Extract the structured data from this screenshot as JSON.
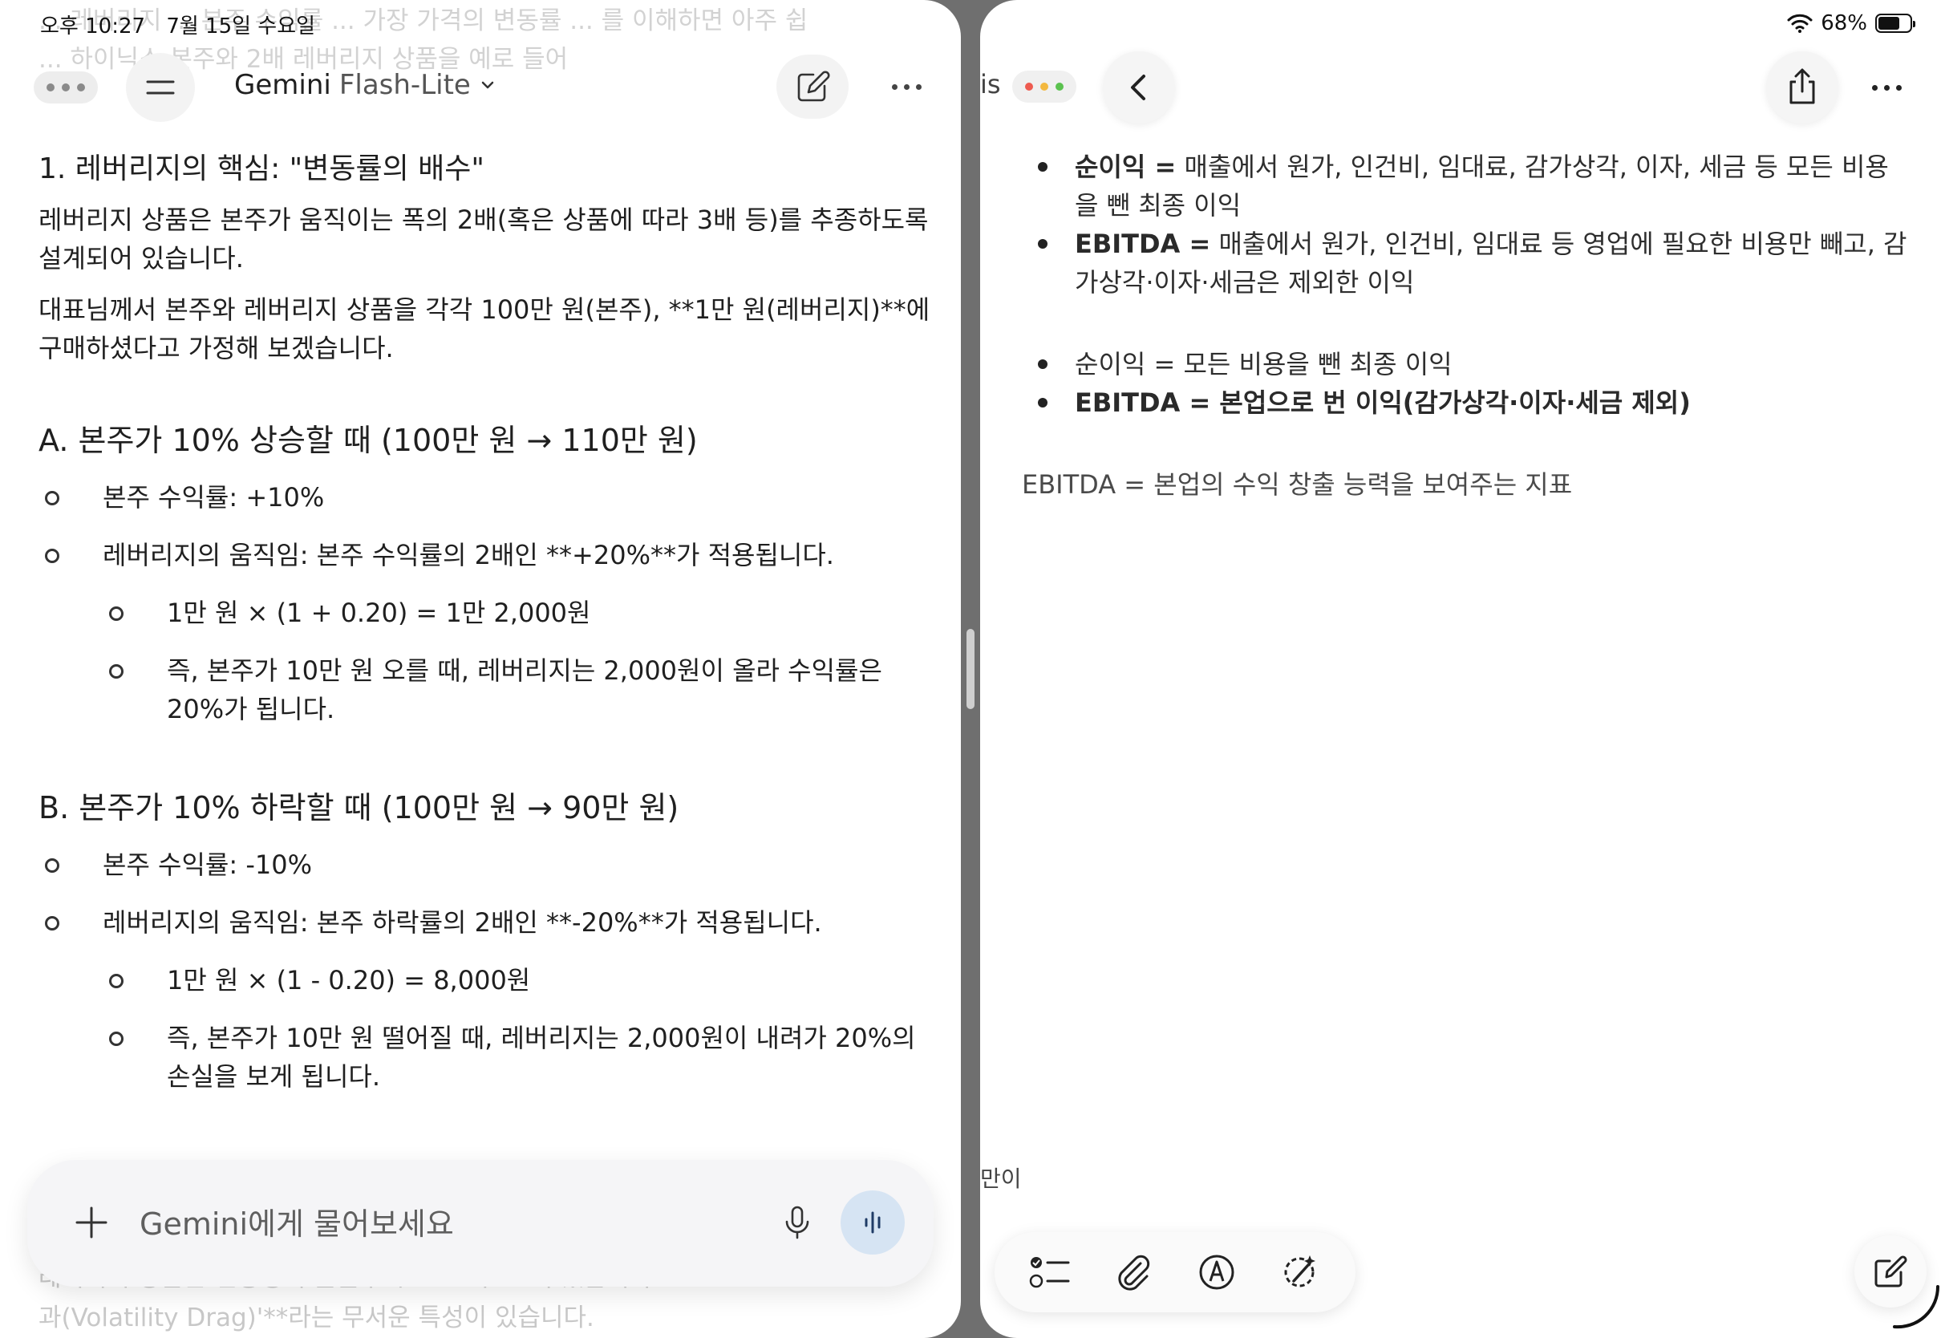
{
  "status": {
    "time": "오후 10:27",
    "date": "7월 15일 수요일",
    "battery": "68%",
    "battery_level": 0.68
  },
  "gemini": {
    "ghost_top_line1": "... 레버리지 ... 본주 수익률 ... 가장 가격의 변동률 ... 를 이해하면 아주 쉽",
    "ghost_top_line2": "... 하이닉스 본주와 2배 레버리지 상품을 예로 들어",
    "app_name": "Gemini",
    "model": "Flash-Lite",
    "section1_title": "1. 레버리지의 핵심: \"변동률의 배수\"",
    "para1": "레버리지 상품은 본주가 움직이는 폭의 2배(혹은 상품에 따라 3배 등)를 추종하도록 설계되어 있습니다.",
    "para2": "대표님께서 본주와 레버리지 상품을 각각 100만 원(본주), **1만 원(레버리지)**에 구매하셨다고 가정해 보겠습니다.",
    "sectionA": {
      "title": "A. 본주가 10% 상승할 때 (100만 원 → 110만 원)",
      "bullet1": "본주 수익률: +10%",
      "bullet2": "레버리지의 움직임: 본주 수익률의 2배인 **+20%**가 적용됩니다.",
      "sub1": "1만 원 × (1 + 0.20) = 1만 2,000원",
      "sub2": "즉, 본주가 10만 원 오를 때, 레버리지는 2,000원이 올라 수익률은 20%가 됩니다."
    },
    "sectionB": {
      "title": "B. 본주가 10% 하락할 때 (100만 원 → 90만 원)",
      "bullet1": "본주 수익률: -10%",
      "bullet2": "레버리지의 움직임: 본주 하락률의 2배인 **-20%**가 적용됩니다.",
      "sub1": "1만 원 × (1 - 0.20) = 8,000원",
      "sub2": "즉, 본주가 10만 원 떨어질 때, 레버리지는 2,000원이 내려가 20%의 손실을 보게 됩니다."
    },
    "ghost_bottom_line1": "레버리지 상품은 변동성이 높을수록 ... 효과 ... 이 있습니다",
    "ghost_bottom_line2": "과(Volatility Drag)'**라는 무서운 특성이 있습니다.",
    "input_placeholder": "Gemini에게 물어보세요"
  },
  "peek": {
    "text1": "is",
    "text2": "만이"
  },
  "note": {
    "list1": [
      {
        "term": "순이익 =",
        "desc": " 매출에서 원가, 인건비, 임대료, 감가상각, 이자, 세금 등 모든 비용을 뺀 최종 이익"
      },
      {
        "term": "EBITDA =",
        "desc": " 매출에서 원가, 인건비, 임대료 등 영업에 필요한 비용만 빼고, 감가상각·이자·세금은 제외한 이익"
      }
    ],
    "list2": [
      {
        "term": "순이익 =",
        "desc": " 모든 비용을 뺀 최종 이익"
      },
      {
        "term": "EBITDA =",
        "desc": " 본업으로 번 이익(감가상각·이자·세금 제외)"
      }
    ],
    "summary": "EBITDA = 본업의 수익 창출 능력을 보여주는 지표"
  },
  "icons": {
    "menu": "menu-icon",
    "chevron": "chevron-down-icon",
    "edit": "edit-icon",
    "plus": "plus-icon",
    "mic": "mic-icon",
    "voice": "voice-mode-icon",
    "back": "back-icon",
    "share": "share-icon",
    "checklist": "checklist-icon",
    "attachment": "paperclip-icon",
    "markup": "markup-pen-icon",
    "ai": "apple-intelligence-icon",
    "compose": "compose-icon"
  },
  "colors": {
    "voice_button": "#d6e4f3",
    "traffic_red": "#ee5b50",
    "traffic_yellow": "#f3b83f",
    "traffic_green": "#5bc24f"
  }
}
